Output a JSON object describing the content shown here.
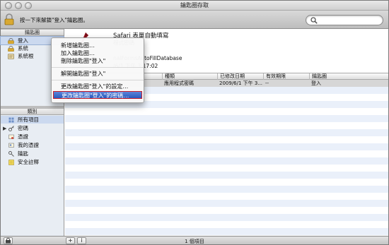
{
  "window": {
    "title": "鑰匙圈存取"
  },
  "toolbar": {
    "lock_hint": "按一下來解鎖\"登入\"鑰匙圈。"
  },
  "keychains": {
    "header": "鑰匙圈",
    "items": [
      {
        "label": "登入",
        "icon": "keychain-icon"
      },
      {
        "label": "系統",
        "icon": "keychain-icon"
      },
      {
        "label": "系統根",
        "icon": "keychain-icon"
      }
    ]
  },
  "categories": {
    "header": "類別",
    "items": [
      {
        "label": "所有項目",
        "icon": "all-items-icon"
      },
      {
        "label": "密碼",
        "icon": "password-icon"
      },
      {
        "label": "憑證",
        "icon": "certificate-icon"
      },
      {
        "label": "我的憑證",
        "icon": "my-certificate-icon"
      },
      {
        "label": "鑰匙",
        "icon": "key-icon"
      },
      {
        "label": "安全註釋",
        "icon": "secure-note-icon"
      }
    ]
  },
  "info": {
    "name": "Safari 表單自動填寫",
    "kind": "程式密碼",
    "where": "nalFormsAutoFillDatabase",
    "date": "/6/1 下午 3:17:02"
  },
  "table": {
    "columns": [
      "種類",
      "已修改日期",
      "有效期限",
      "鑰匙圈"
    ],
    "rows": [
      {
        "kind": "應用程式密碼",
        "modified": "2009/6/1 下午 3...",
        "expires": "--",
        "keychain": "登入"
      }
    ]
  },
  "context_menu": {
    "items": [
      "新增鑰匙圈…",
      "加入鑰匙圈…",
      "刪除鑰匙圈\"登入\"",
      "解開鑰匙圈\"登入\"",
      "更改鑰匙圈\"登入\"的設定…",
      "更改鑰匙圈\"登入\"的密碼…"
    ]
  },
  "status": {
    "text": "1 個項目",
    "add_label": "+",
    "info_label": "i"
  },
  "colors": {
    "accent": "#2a5bbd",
    "selection": "#cbd9ef",
    "row_alt": "#eaf0fa",
    "highlight_border": "#cc1f2a"
  }
}
